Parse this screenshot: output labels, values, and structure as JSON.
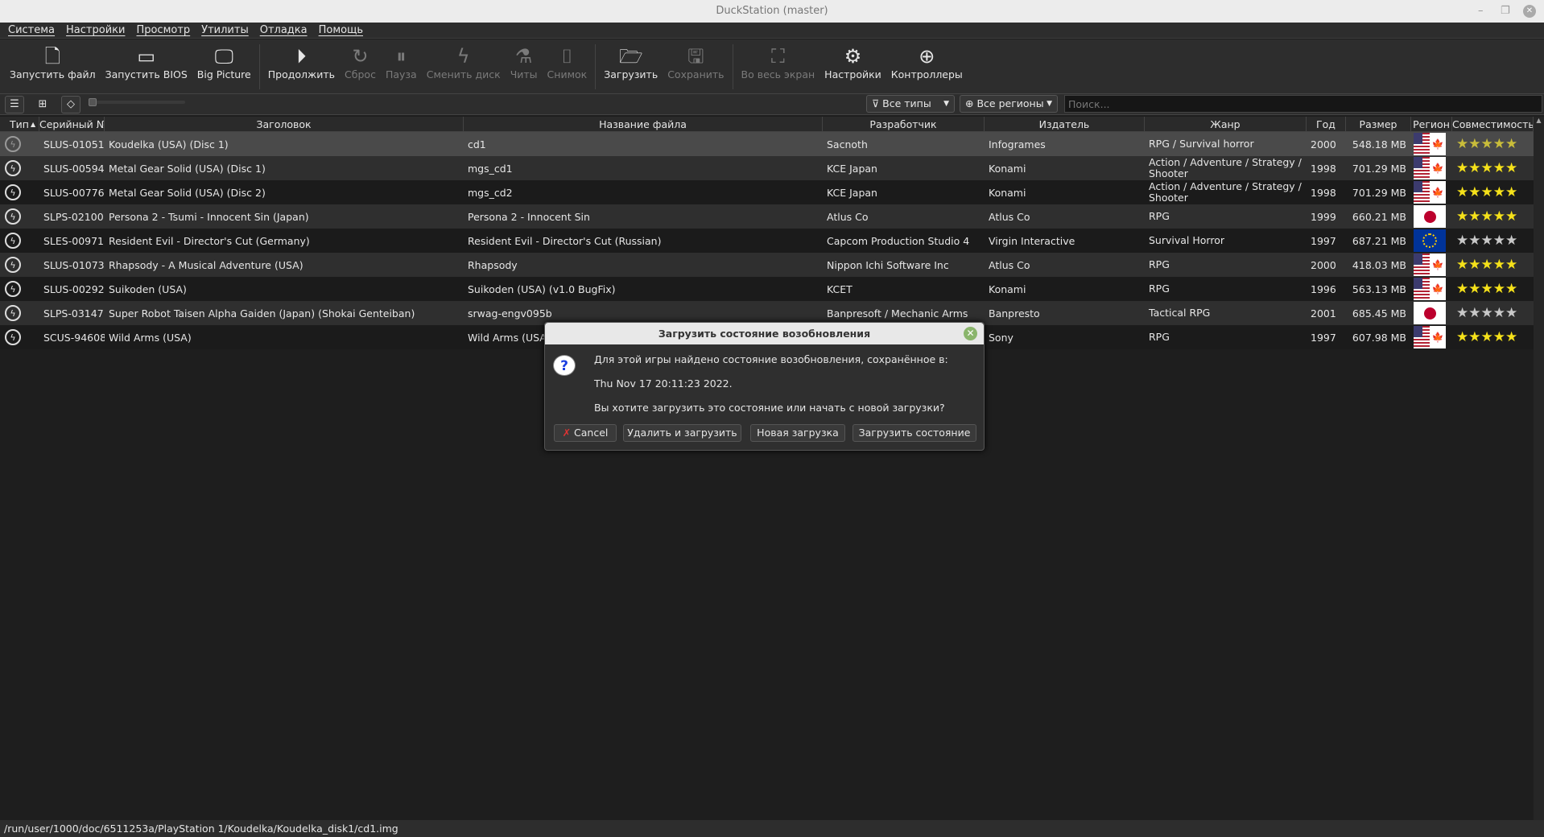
{
  "window": {
    "title": "DuckStation (master)",
    "minimize": "–",
    "maximize": "❐",
    "close": "✕"
  },
  "menu": [
    "Система",
    "Настройки",
    "Просмотр",
    "Утилиты",
    "Отладка",
    "Помощь"
  ],
  "toolbar": [
    {
      "label": "Запустить файл",
      "icon": "file-icon",
      "glyph": "🗋",
      "enabled": true
    },
    {
      "label": "Запустить BIOS",
      "icon": "console-icon",
      "glyph": "▭",
      "enabled": true
    },
    {
      "label": "Big Picture",
      "icon": "monitor-icon",
      "glyph": "🖵",
      "enabled": true
    },
    {
      "label": "Продолжить",
      "icon": "play-icon",
      "glyph": "⏵",
      "enabled": true
    },
    {
      "label": "Сброс",
      "icon": "reset-icon",
      "glyph": "↻",
      "enabled": false
    },
    {
      "label": "Пауза",
      "icon": "pause-icon",
      "glyph": "⏸",
      "enabled": false
    },
    {
      "label": "Сменить диск",
      "icon": "disc-change-icon",
      "glyph": "ϟ",
      "enabled": false
    },
    {
      "label": "Читы",
      "icon": "flask-icon",
      "glyph": "⚗",
      "enabled": false
    },
    {
      "label": "Снимок",
      "icon": "screenshot-icon",
      "glyph": "⌷",
      "enabled": false
    },
    {
      "label": "Загрузить",
      "icon": "folder-open-icon",
      "glyph": "🗁",
      "enabled": true
    },
    {
      "label": "Сохранить",
      "icon": "save-icon",
      "glyph": "🖫",
      "enabled": false
    },
    {
      "label": "Во весь экран",
      "icon": "fullscreen-icon",
      "glyph": "⛶",
      "enabled": false
    },
    {
      "label": "Настройки",
      "icon": "gear-icon",
      "glyph": "⚙",
      "enabled": true
    },
    {
      "label": "Контроллеры",
      "icon": "gamepad-icon",
      "glyph": "⊕",
      "enabled": true
    }
  ],
  "filters": {
    "types": "Все типы",
    "regions": "Все регионы",
    "search_placeholder": "Поиск..."
  },
  "columns": [
    "Тип",
    "Серийный №",
    "Заголовок",
    "Название файла",
    "Разработчик",
    "Издатель",
    "Жанр",
    "Год",
    "Размер",
    "Регион",
    "Совместимость"
  ],
  "rows": [
    {
      "serial": "SLUS-01051",
      "title": "Koudelka (USA) (Disc 1)",
      "file": "cd1",
      "developer": "Sacnoth",
      "publisher": "Infogrames",
      "genre": "RPG / Survival horror",
      "year": "2000",
      "size": "548.18 MB",
      "region": "us-ca",
      "rating": 5
    },
    {
      "serial": "SLUS-00594",
      "title": "Metal Gear Solid (USA) (Disc 1)",
      "file": "mgs_cd1",
      "developer": "KCE Japan",
      "publisher": "Konami",
      "genre": "Action / Adventure / Strategy / Shooter",
      "year": "1998",
      "size": "701.29 MB",
      "region": "us-ca",
      "rating": 5
    },
    {
      "serial": "SLUS-00776",
      "title": "Metal Gear Solid (USA) (Disc 2)",
      "file": "mgs_cd2",
      "developer": "KCE Japan",
      "publisher": "Konami",
      "genre": "Action / Adventure / Strategy / Shooter",
      "year": "1998",
      "size": "701.29 MB",
      "region": "us-ca",
      "rating": 5
    },
    {
      "serial": "SLPS-02100",
      "title": "Persona 2 - Tsumi - Innocent Sin (Japan)",
      "file": "Persona 2 - Innocent Sin",
      "developer": "Atlus Co",
      "publisher": "Atlus Co",
      "genre": "RPG",
      "year": "1999",
      "size": "660.21 MB",
      "region": "jp",
      "rating": 5
    },
    {
      "serial": "SLES-00971",
      "title": "Resident Evil - Director's Cut (Germany)",
      "file": "Resident Evil - Director's Cut (Russian)",
      "developer": "Capcom Production Studio 4",
      "publisher": "Virgin Interactive",
      "genre": "Survival Horror",
      "year": "1997",
      "size": "687.21 MB",
      "region": "eu",
      "rating": 0
    },
    {
      "serial": "SLUS-01073",
      "title": "Rhapsody - A Musical Adventure (USA)",
      "file": "Rhapsody",
      "developer": "Nippon Ichi Software Inc",
      "publisher": "Atlus Co",
      "genre": "RPG",
      "year": "2000",
      "size": "418.03 MB",
      "region": "us-ca",
      "rating": 5
    },
    {
      "serial": "SLUS-00292",
      "title": "Suikoden (USA)",
      "file": "Suikoden (USA) (v1.0 BugFix)",
      "developer": "KCET",
      "publisher": "Konami",
      "genre": "RPG",
      "year": "1996",
      "size": "563.13 MB",
      "region": "us-ca",
      "rating": 5
    },
    {
      "serial": "SLPS-03147",
      "title": "Super Robot Taisen Alpha Gaiden (Japan) (Shokai Genteiban)",
      "file": "srwag-engv095b",
      "developer": "Banpresoft / Mechanic Arms",
      "publisher": "Banpresto",
      "genre": "Tactical RPG",
      "year": "2001",
      "size": "685.45 MB",
      "region": "jp",
      "rating": 0
    },
    {
      "serial": "SCUS-94608",
      "title": "Wild Arms (USA)",
      "file": "Wild Arms (USA)",
      "developer": "",
      "publisher": "Sony",
      "genre": "RPG",
      "year": "1997",
      "size": "607.98 MB",
      "region": "us-ca",
      "rating": 5
    }
  ],
  "status": "/run/user/1000/doc/6511253a/PlayStation 1/Koudelka/Koudelka_disk1/cd1.img",
  "dialog": {
    "title": "Загрузить состояние возобновления",
    "line1": "Для этой игры найдено состояние возобновления, сохранённое в:",
    "line2": "Thu Nov 17 20:11:23 2022.",
    "line3": "Вы хотите загрузить это состояние или начать с новой загрузки?",
    "cancel": "Cancel",
    "delete_load": "Удалить и загрузить",
    "new_boot": "Новая загрузка",
    "load_state": "Загрузить состояние"
  },
  "colors": {
    "star_on": "#f5e11a",
    "star_off": "#c8c8c8",
    "selected_row": "#4a4a4a"
  }
}
